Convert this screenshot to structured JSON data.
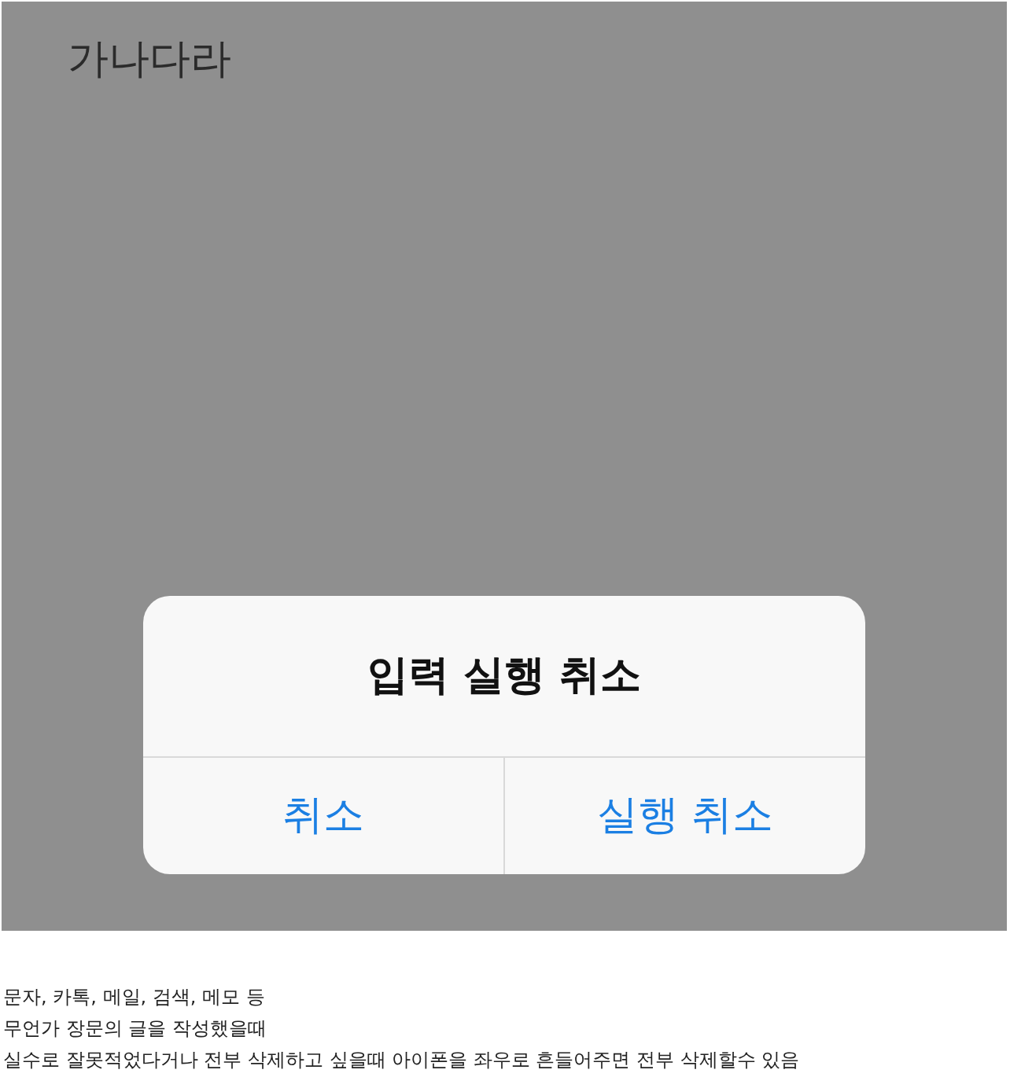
{
  "screenshot": {
    "note_text": "가나다라",
    "alert": {
      "title": "입력 실행 취소",
      "buttons": [
        {
          "label": "취소"
        },
        {
          "label": "실행 취소"
        }
      ]
    }
  },
  "caption": [
    "문자, 카톡, 메일, 검색, 메모 등",
    "무언가 장문의 글을 작성했을때",
    "실수로 잘못적었다거나 전부 삭제하고 싶을때 아이폰을 좌우로 흔들어주면 전부 삭제할수 있음"
  ]
}
